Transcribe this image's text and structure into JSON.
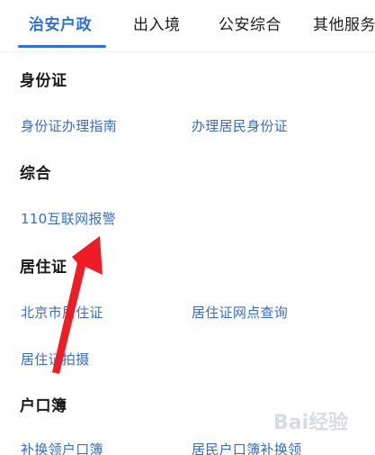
{
  "tabs": [
    {
      "label": "治安户政",
      "active": true
    },
    {
      "label": "出入境",
      "active": false
    },
    {
      "label": "公安综合",
      "active": false
    },
    {
      "label": "其他服务",
      "active": false
    }
  ],
  "sections": [
    {
      "title": "身份证",
      "links": [
        "身份证办理指南",
        "办理居民身份证"
      ]
    },
    {
      "title": "综合",
      "links": [
        "110互联网报警"
      ]
    },
    {
      "title": "居住证",
      "links": [
        "北京市居住证",
        "居住证网点查询",
        "居住证拍摄"
      ]
    },
    {
      "title": "户口簿",
      "links": [
        "补换领户口簿",
        "居民户口簿补换领"
      ]
    }
  ],
  "watermark": {
    "text": "Bai经验"
  },
  "colors": {
    "accent": "#2f6fd6",
    "link": "#3a6fb7",
    "arrow": "#ee1c25"
  }
}
